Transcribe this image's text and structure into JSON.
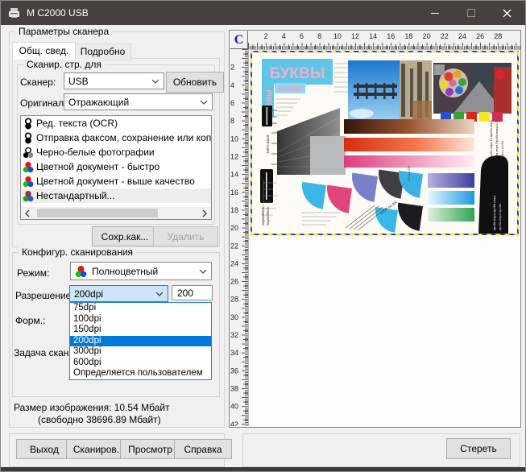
{
  "window": {
    "title": "M C2000 USB"
  },
  "scanner_panel": {
    "group_label": "Параметры сканера",
    "tabs": {
      "general": "Общ. свед.",
      "details": "Подробно"
    },
    "scan_for": {
      "group_label": "Сканир. стр. для",
      "scanner_label": "Сканер:",
      "scanner_value": "USB",
      "refresh_button": "Обновить",
      "original_label": "Оригинал:",
      "original_value": "Отражающий",
      "tasks": [
        {
          "label": "Ред. текста (OCR)",
          "icon": "bw-circles-icon"
        },
        {
          "label": "Отправка факсом, сохранение или копирование",
          "icon": "bw-circles-icon"
        },
        {
          "label": "Черно-белые фотографии",
          "icon": "grayscale-circles-icon"
        },
        {
          "label": "Цветной документ - быстро",
          "icon": "rgb-circles-icon"
        },
        {
          "label": "Цветной документ - выше качество",
          "icon": "rgb-circles-icon"
        },
        {
          "label": "Нестандартный...",
          "icon": "rgb-muted-circles-icon"
        }
      ],
      "save_as_button": "Сохр.как...",
      "delete_button": "Удалить"
    },
    "scan_config": {
      "group_label": "Конфигур. сканирования",
      "mode_label": "Режим:",
      "mode_value": "Полноцветный",
      "resolution_label": "Разрешение:",
      "resolution_value": "200dpi",
      "resolution_custom": "200",
      "resolution_options": [
        "75dpi",
        "100dpi",
        "150dpi",
        "200dpi",
        "300dpi",
        "600dpi",
        "Определяется пользователем"
      ],
      "resolution_selected": "200dpi",
      "format_label": "Форм.:",
      "task_label": "Задача скан."
    },
    "image_size_line1": "Размер изображения: 10.54 Мбайт",
    "image_size_line2": "(свободно 38696.89 Мбайт)"
  },
  "actions": {
    "exit": "Выход",
    "scan": "Сканиров.",
    "preview": "Просмотр",
    "help": "Справка"
  },
  "preview": {
    "unit_button": "C",
    "h_ruler_numbers": [
      2,
      4,
      6,
      8,
      10,
      12,
      14,
      16,
      18,
      20,
      22,
      24,
      26,
      28
    ],
    "v_ruler_numbers": [
      2,
      4,
      6,
      8,
      10,
      12,
      14,
      16,
      18,
      20,
      22,
      24,
      26,
      28,
      30,
      32,
      34,
      36,
      38,
      40,
      42
    ],
    "erase_button": "Стереть",
    "chart_texts": {
      "letters_big": "БУКВЫ",
      "letters_small": "БУКВЫ",
      "letters_vertical": "БУКВЫ",
      "black_label": "100% Black",
      "superblack_label": "SuperBlack"
    }
  }
}
